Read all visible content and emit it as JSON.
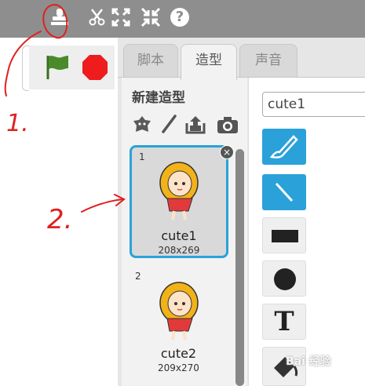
{
  "toolbar": {
    "icons": [
      "stamp-icon",
      "scissors-icon",
      "grow-icon",
      "shrink-icon",
      "help-icon"
    ],
    "help_glyph": "?"
  },
  "controls": {
    "flag_color": "#4a8a2a",
    "stop_color": "#ee1c1c"
  },
  "tabs": [
    {
      "label": "脚本",
      "active": false
    },
    {
      "label": "造型",
      "active": true
    },
    {
      "label": "声音",
      "active": false
    }
  ],
  "costumes_panel": {
    "new_costume_label": "新建造型",
    "new_icons": [
      "choose-from-library-icon",
      "paint-new-icon",
      "upload-icon",
      "camera-icon"
    ],
    "items": [
      {
        "number": "1",
        "name": "cute1",
        "size": "208x269",
        "selected": true
      },
      {
        "number": "2",
        "name": "cute2",
        "size": "209x270",
        "selected": false
      }
    ],
    "delete_glyph": "×"
  },
  "editor": {
    "costume_name_value": "cute1",
    "tools": [
      "brush-tool-icon",
      "line-tool-icon",
      "rectangle-tool-icon",
      "ellipse-tool-icon",
      "text-tool-icon",
      "fill-tool-icon"
    ],
    "text_tool_glyph": "T",
    "accent": "#2aa2d9"
  },
  "annotations": {
    "mark1": "1.",
    "mark2": "2.",
    "ink_color": "#e02020"
  },
  "watermark": "Bai 经验"
}
